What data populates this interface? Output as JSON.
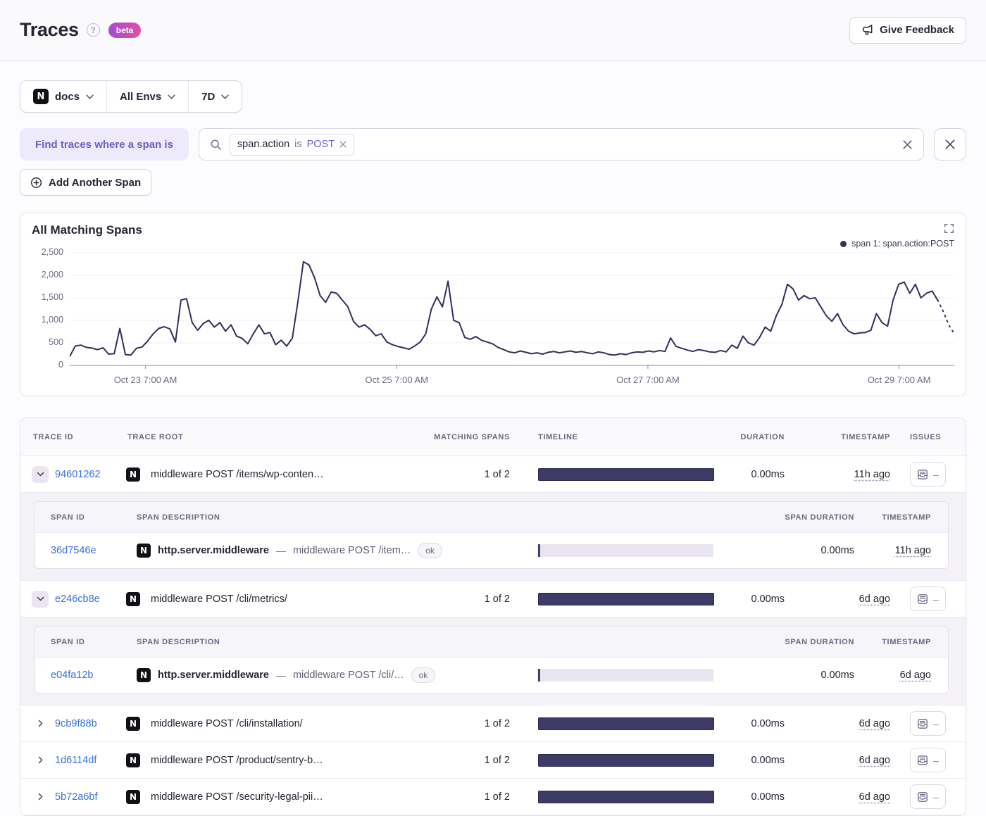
{
  "header": {
    "title": "Traces",
    "beta_label": "beta",
    "feedback_label": "Give Feedback"
  },
  "filters": {
    "project": "docs",
    "environment": "All Envs",
    "period": "7D"
  },
  "query": {
    "where_label": "Find traces where a span is",
    "token": {
      "key": "span.action",
      "op": "is",
      "value": "POST"
    },
    "add_span_label": "Add Another Span"
  },
  "chart": {
    "title": "All Matching Spans",
    "legend": "span 1: span.action:POST"
  },
  "colors": {
    "accent_purple": "#6c5fc7",
    "link_blue": "#3672de",
    "bar_navy": "#3e3b66",
    "line_navy": "#332f5c",
    "beta_gradient_start": "#a24bd3",
    "beta_gradient_end": "#e3509d"
  },
  "chart_data": {
    "type": "line",
    "title": "All Matching Spans",
    "xlabel": "",
    "ylabel": "",
    "ylim": [
      0,
      2500
    ],
    "yticks": [
      0,
      500,
      1000,
      1500,
      2000,
      2500
    ],
    "ytick_labels": [
      "0",
      "500",
      "1,000",
      "1,500",
      "2,000",
      "2,500"
    ],
    "grid": true,
    "legend_position": "top-right",
    "line_color": "#332f5c",
    "x_ticks": [
      {
        "label": "Oct 23 7:00 AM",
        "frac": 0.0856
      },
      {
        "label": "Oct 25 7:00 AM",
        "frac": 0.3696
      },
      {
        "label": "Oct 27 7:00 AM",
        "frac": 0.6536
      },
      {
        "label": "Oct 29 7:00 AM",
        "frac": 0.9376
      }
    ],
    "dashed_from_index": 156,
    "series": [
      {
        "name": "span 1: span.action:POST",
        "values": [
          200,
          430,
          450,
          400,
          385,
          350,
          390,
          250,
          260,
          820,
          240,
          230,
          380,
          410,
          540,
          700,
          820,
          860,
          810,
          520,
          1450,
          1480,
          950,
          780,
          930,
          1000,
          850,
          950,
          760,
          900,
          650,
          600,
          480,
          700,
          900,
          700,
          730,
          460,
          560,
          430,
          600,
          1400,
          2300,
          2230,
          1950,
          1550,
          1400,
          1630,
          1600,
          1450,
          1300,
          980,
          850,
          900,
          800,
          660,
          700,
          520,
          460,
          420,
          390,
          360,
          430,
          520,
          700,
          1250,
          1520,
          1300,
          1870,
          1000,
          950,
          620,
          580,
          640,
          560,
          520,
          480,
          400,
          350,
          300,
          280,
          320,
          290,
          260,
          280,
          250,
          290,
          310,
          280,
          300,
          320,
          290,
          310,
          280,
          260,
          300,
          280,
          240,
          230,
          260,
          240,
          280,
          300,
          290,
          320,
          300,
          330,
          310,
          610,
          420,
          380,
          340,
          310,
          350,
          330,
          300,
          290,
          330,
          300,
          450,
          380,
          650,
          500,
          450,
          620,
          850,
          760,
          1100,
          1350,
          1800,
          1700,
          1450,
          1550,
          1480,
          1500,
          1300,
          1100,
          980,
          1150,
          900,
          760,
          700,
          720,
          730,
          780,
          1150,
          950,
          870,
          1450,
          1800,
          1850,
          1600,
          1800,
          1500,
          1600,
          1650,
          1450,
          1200,
          900,
          700
        ]
      }
    ]
  },
  "table": {
    "project_icon": "N",
    "columns": [
      "TRACE ID",
      "TRACE ROOT",
      "MATCHING SPANS",
      "TIMELINE",
      "DURATION",
      "TIMESTAMP",
      "ISSUES"
    ],
    "span_columns": [
      "SPAN ID",
      "SPAN DESCRIPTION",
      "SPAN DURATION",
      "TIMESTAMP"
    ],
    "rows": [
      {
        "trace_id": "94601262",
        "root": "middleware POST /items/wp-conten…",
        "matching": "1 of 2",
        "duration": "0.00ms",
        "age": "11h ago",
        "issues": "–",
        "expanded": true,
        "spans": [
          {
            "span_id": "36d7546e",
            "op": "http.server.middleware",
            "sep": "—",
            "desc": "middleware POST /item…",
            "status": "ok",
            "duration": "0.00ms",
            "age": "11h ago"
          }
        ]
      },
      {
        "trace_id": "e246cb8e",
        "root": "middleware POST /cli/metrics/",
        "matching": "1 of 2",
        "duration": "0.00ms",
        "age": "6d ago",
        "issues": "–",
        "expanded": true,
        "spans": [
          {
            "span_id": "e04fa12b",
            "op": "http.server.middleware",
            "sep": "—",
            "desc": "middleware POST /cli/…",
            "status": "ok",
            "duration": "0.00ms",
            "age": "6d ago"
          }
        ]
      },
      {
        "trace_id": "9cb9f88b",
        "root": "middleware POST /cli/installation/",
        "matching": "1 of 2",
        "duration": "0.00ms",
        "age": "6d ago",
        "issues": "–",
        "expanded": false
      },
      {
        "trace_id": "1d6114df",
        "root": "middleware POST /product/sentry-b…",
        "matching": "1 of 2",
        "duration": "0.00ms",
        "age": "6d ago",
        "issues": "–",
        "expanded": false
      },
      {
        "trace_id": "5b72a6bf",
        "root": "middleware POST /security-legal-pii…",
        "matching": "1 of 2",
        "duration": "0.00ms",
        "age": "6d ago",
        "issues": "–",
        "expanded": false
      }
    ]
  }
}
